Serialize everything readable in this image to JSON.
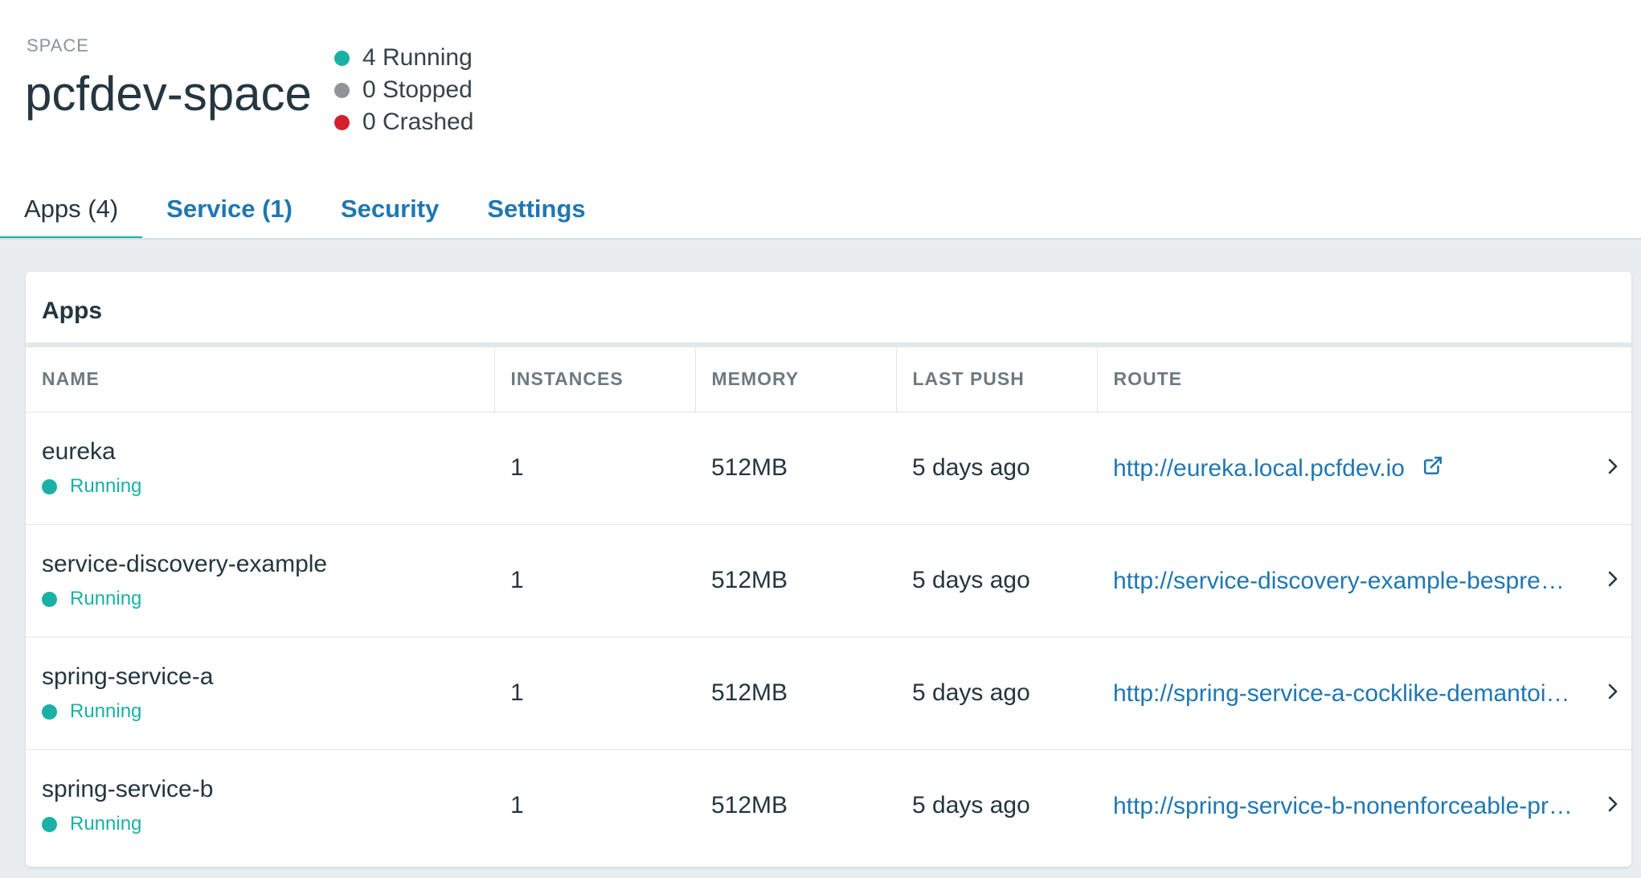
{
  "header": {
    "space_label": "SPACE",
    "space_name": "pcfdev-space",
    "statuses": [
      {
        "label": "4 Running",
        "color": "#1ab0a6"
      },
      {
        "label": "0 Stopped",
        "color": "#8f9497"
      },
      {
        "label": "0 Crashed",
        "color": "#d4202e"
      }
    ]
  },
  "tabs": [
    {
      "label": "Apps (4)",
      "active": true
    },
    {
      "label": "Service (1)",
      "active": false
    },
    {
      "label": "Security",
      "active": false
    },
    {
      "label": "Settings",
      "active": false
    }
  ],
  "apps_card": {
    "title": "Apps",
    "columns": [
      "NAME",
      "INSTANCES",
      "MEMORY",
      "LAST PUSH",
      "ROUTE"
    ],
    "rows": [
      {
        "name": "eureka",
        "status": "Running",
        "instances": "1",
        "memory": "512MB",
        "last_push": "5 days ago",
        "route": "http://eureka.local.pcfdev.io",
        "external_icon": true
      },
      {
        "name": "service-discovery-example",
        "status": "Running",
        "instances": "1",
        "memory": "512MB",
        "last_push": "5 days ago",
        "route": "http://service-discovery-example-bespre…",
        "external_icon": false
      },
      {
        "name": "spring-service-a",
        "status": "Running",
        "instances": "1",
        "memory": "512MB",
        "last_push": "5 days ago",
        "route": "http://spring-service-a-cocklike-demantoi…",
        "external_icon": false
      },
      {
        "name": "spring-service-b",
        "status": "Running",
        "instances": "1",
        "memory": "512MB",
        "last_push": "5 days ago",
        "route": "http://spring-service-b-nonenforceable-pr…",
        "external_icon": false
      }
    ]
  },
  "colors": {
    "accent": "#1ab0a6",
    "link": "#1f77b2",
    "background": "#e9edef"
  },
  "icons": {
    "external": "external-link-icon",
    "row_arrow": "chevron-right-icon"
  }
}
